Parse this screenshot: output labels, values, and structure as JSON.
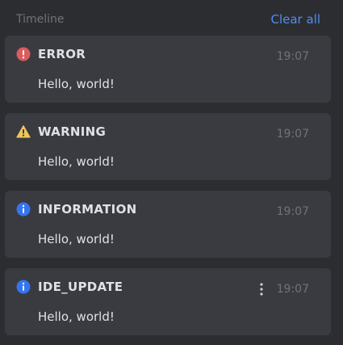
{
  "header": {
    "title": "Timeline",
    "clear_all": "Clear all"
  },
  "notifications": [
    {
      "type": "error",
      "icon": "error-icon",
      "title": "ERROR",
      "time": "19:07",
      "body": "Hello, world!"
    },
    {
      "type": "warning",
      "icon": "warning-icon",
      "title": "WARNING",
      "time": "19:07",
      "body": "Hello, world!"
    },
    {
      "type": "information",
      "icon": "info-icon",
      "title": "INFORMATION",
      "time": "19:07",
      "body": "Hello, world!"
    },
    {
      "type": "ide_update",
      "icon": "info-icon",
      "title": "IDE_UPDATE",
      "time": "19:07",
      "body": "Hello, world!",
      "more_menu_icon": "more-vertical-icon"
    }
  ],
  "colors": {
    "background": "#2b2d30",
    "card": "#393b40",
    "accent": "#548af7",
    "error": "#db5c5c",
    "warning": "#f2c55c",
    "info": "#3574f0",
    "text": "#dfe1e5",
    "muted": "#6f737a"
  }
}
